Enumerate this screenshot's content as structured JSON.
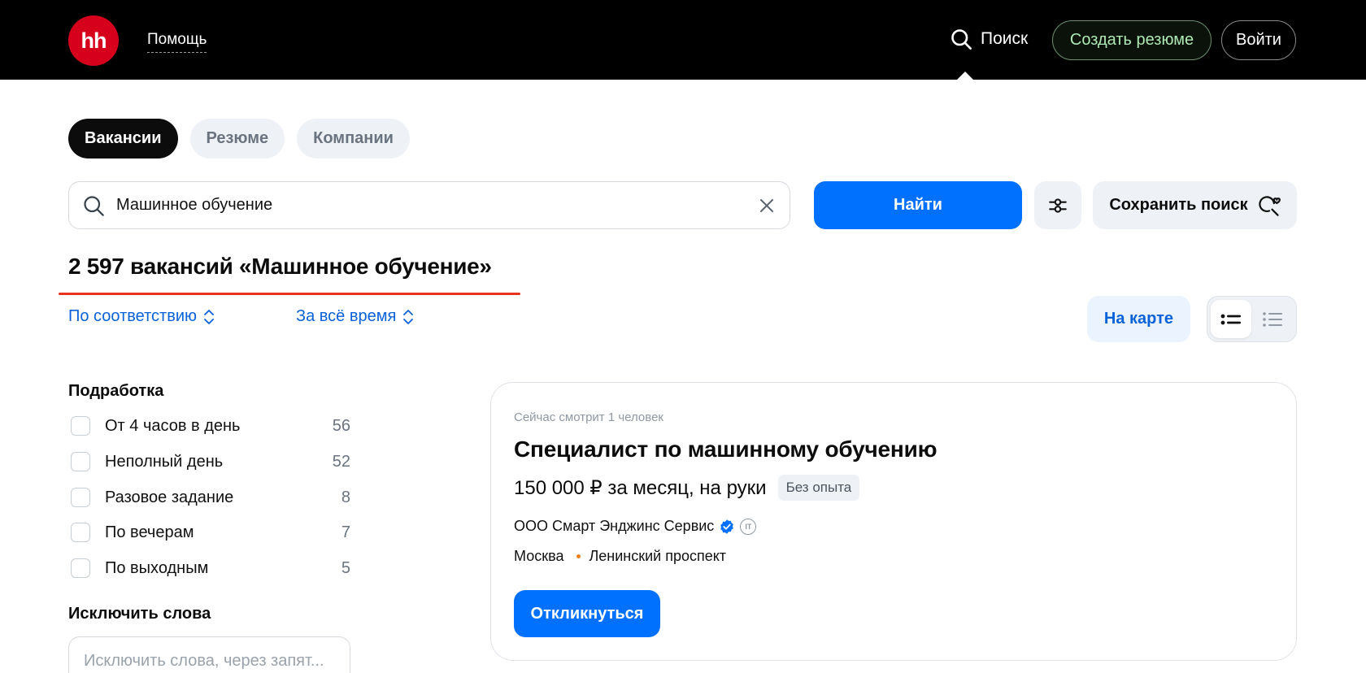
{
  "header": {
    "logo_text": "hh",
    "help_label": "Помощь",
    "search_label": "Поиск",
    "create_resume_label": "Создать резюме",
    "login_label": "Войти"
  },
  "tabs": [
    {
      "label": "Вакансии",
      "active": true
    },
    {
      "label": "Резюме",
      "active": false
    },
    {
      "label": "Компании",
      "active": false
    }
  ],
  "search": {
    "value": "Машинное обучение",
    "find_label": "Найти",
    "save_label": "Сохранить поиск"
  },
  "results": {
    "title": "2 597 вакансий «Машинное обучение»"
  },
  "sorting": {
    "relevance_label": "По соответствию",
    "period_label": "За всё время",
    "map_label": "На карте"
  },
  "sidebar": {
    "parttime_title": "Подработка",
    "filters": [
      {
        "label": "От 4 часов в день",
        "count": "56"
      },
      {
        "label": "Неполный день",
        "count": "52"
      },
      {
        "label": "Разовое задание",
        "count": "8"
      },
      {
        "label": "По вечерам",
        "count": "7"
      },
      {
        "label": "По выходным",
        "count": "5"
      }
    ],
    "exclude_title": "Исключить слова",
    "exclude_placeholder": "Исключить слова, через запят..."
  },
  "vacancy": {
    "viewing": "Сейчас смотрит 1 человек",
    "title": "Специалист по машинному обучению",
    "salary": "150 000 ₽ за месяц, на руки",
    "experience": "Без опыта",
    "company": "ООО Смарт Энджинс Сервис",
    "it_badge": "IT",
    "city": "Москва",
    "metro": "Ленинский проспект",
    "apply_label": "Откликнуться"
  },
  "colors": {
    "brand_red": "#d6001c",
    "primary_blue": "#0070ff",
    "link_blue": "#0a62d9",
    "metro_orange": "#ef7f1a",
    "underline_red": "#e8321e"
  }
}
